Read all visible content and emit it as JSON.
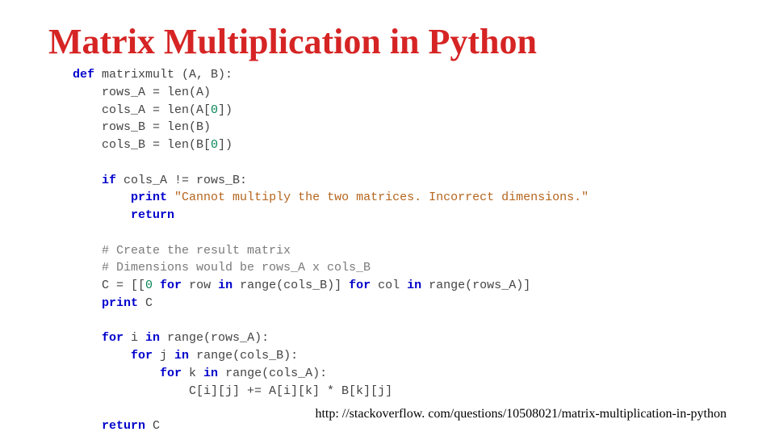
{
  "title": "Matrix Multiplication in Python",
  "code": {
    "line01_def": "def",
    "line01_rest": " matrixmult (A, B):",
    "line02a": "    rows_A = len(A)",
    "line02b": "    cols_A = len(A[",
    "line02b_zero": "0",
    "line02b_end": "])",
    "line02c": "    rows_B = len(B)",
    "line02d": "    cols_B = len(B[",
    "line02d_zero": "0",
    "line02d_end": "])",
    "blank1": "",
    "line03_if": "    if",
    "line03_rest": " cols_A != rows_B:",
    "line04_print": "        print",
    "line04_space": " ",
    "line04_str": "\"Cannot multiply the two matrices. Incorrect dimensions.\"",
    "line05_return": "        return",
    "blank2": "",
    "line06_cmt": "    # Create the result matrix",
    "line07_cmt": "    # Dimensions would be rows_A x cols_B",
    "line08a": "    C = [[",
    "line08_zero": "0",
    "line08b": " ",
    "line08_for1": "for",
    "line08c": " row ",
    "line08_in1": "in",
    "line08d": " range(cols_B)] ",
    "line08_for2": "for",
    "line08e": " col ",
    "line08_in2": "in",
    "line08f": " range(rows_A)]",
    "line09_print": "    print",
    "line09_rest": " C",
    "blank3": "",
    "line10_for": "    for",
    "line10a": " i ",
    "line10_in": "in",
    "line10b": " range(rows_A):",
    "line11_for": "        for",
    "line11a": " j ",
    "line11_in": "in",
    "line11b": " range(cols_B):",
    "line12_for": "            for",
    "line12a": " k ",
    "line12_in": "in",
    "line12b": " range(cols_A):",
    "line13": "                C[i][j] += A[i][k] * B[k][j]",
    "blank4": "",
    "line14_return": "    return",
    "line14_rest": " C"
  },
  "footer_url": "http: //stackoverflow. com/questions/10508021/matrix-multiplication-in-python"
}
